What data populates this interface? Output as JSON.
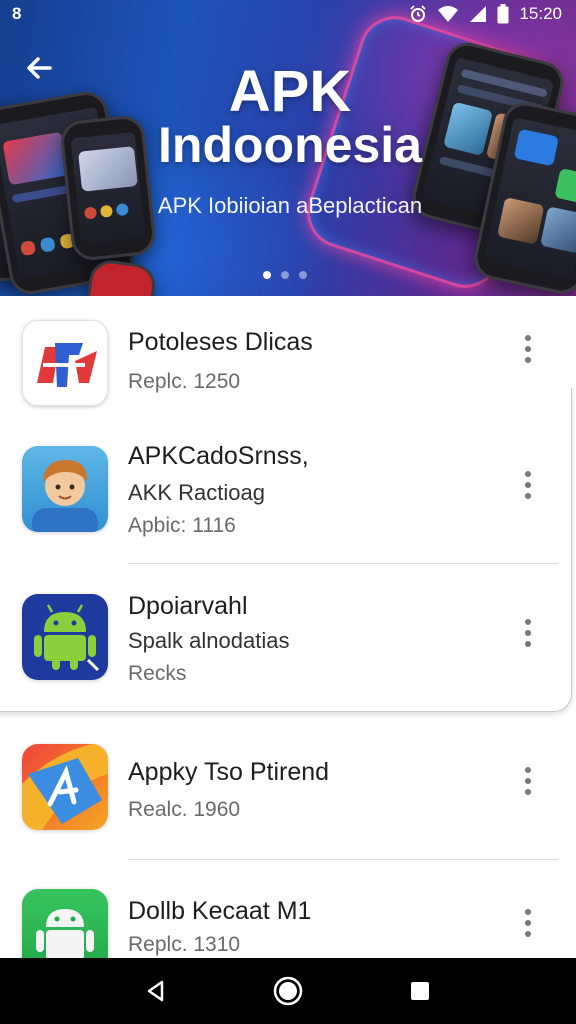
{
  "status_bar": {
    "left_icon": "8",
    "time": "15:20",
    "icons": [
      "alarm-icon",
      "wifi-icon",
      "signal-icon",
      "battery-icon"
    ]
  },
  "banner": {
    "title_line1": "APK",
    "title_line2": "Indoonesia",
    "subtitle": "APK Iobiioian aBeplactican",
    "back_icon": "arrow-left-icon",
    "carousel_pages": 3,
    "carousel_active": 0
  },
  "apps": [
    {
      "title": "Potoleses Dlicas",
      "meta": "Replc. 1250",
      "icon": "red-blue-logo-icon"
    },
    {
      "title": "APKCadoSrnss,",
      "subtitle": "AKK Ractioag",
      "meta": "Apbic: 1116",
      "icon": "cartoon-boy-icon"
    },
    {
      "title": "Dpoiarvahl",
      "subtitle": "Spalk alnodatias",
      "meta": "Recks",
      "icon": "android-robot-icon"
    },
    {
      "title": "Appky Tso Ptirend",
      "meta": "Realc. 1960",
      "icon": "orange-blue-logo-icon"
    },
    {
      "title": "Dollb Kecaat M1",
      "meta": "Replc. 1310",
      "icon": "android-white-icon"
    }
  ],
  "nav_bar": {
    "back": "back-triangle-icon",
    "home": "home-circle-icon",
    "recents": "recents-square-icon"
  },
  "colors": {
    "banner_start": "#153e8f",
    "banner_end": "#7a2f86",
    "neon": "#ff4fa8",
    "nav_bg": "#000000"
  }
}
